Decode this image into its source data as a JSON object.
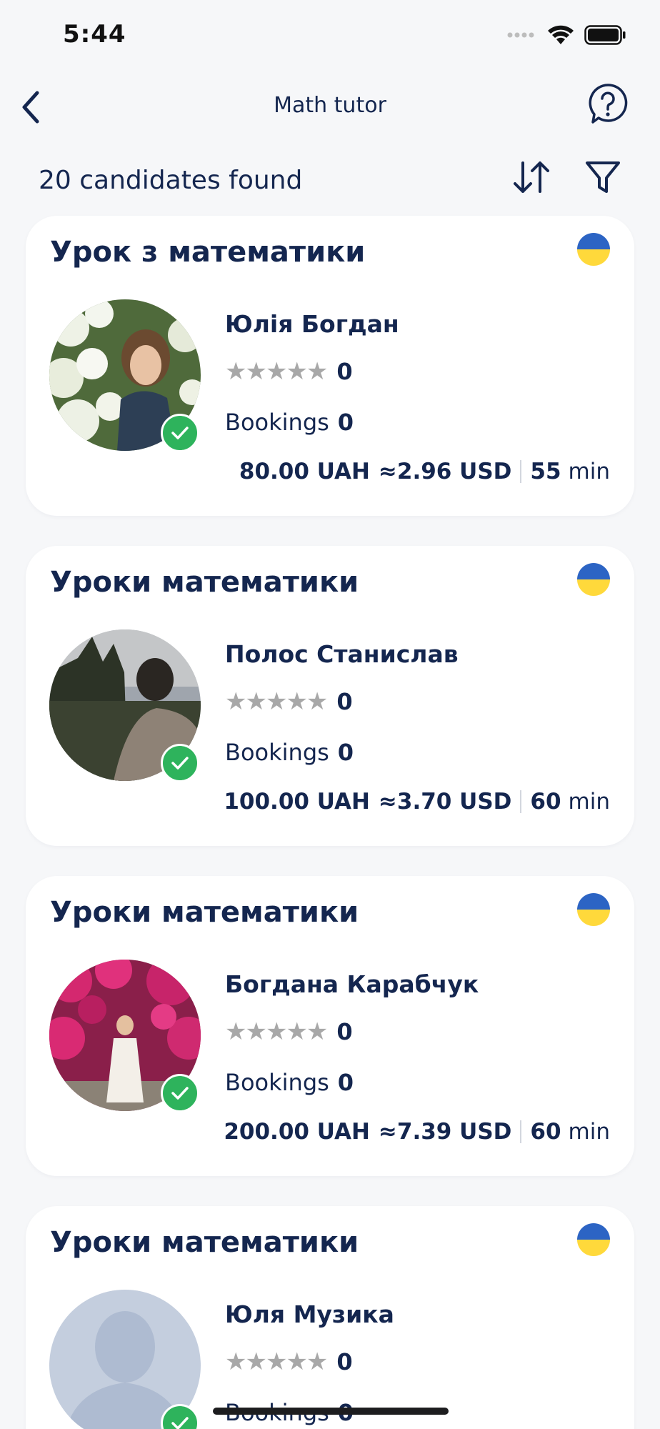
{
  "status": {
    "time": "5:44"
  },
  "nav": {
    "title": "Math tutor"
  },
  "results": {
    "count_label": "20 candidates found"
  },
  "labels": {
    "bookings": "Bookings",
    "stars": "★★★★★"
  },
  "cards": [
    {
      "title": "Урок з математики",
      "name": "Юлія Богдан",
      "rating": "0",
      "bookings": "0",
      "price": "80.00 UAH",
      "approx": "≈2.96 USD",
      "duration_value": "55",
      "duration_unit": "min"
    },
    {
      "title": "Уроки математики",
      "name": "Полос Станислав",
      "rating": "0",
      "bookings": "0",
      "price": "100.00 UAH",
      "approx": "≈3.70 USD",
      "duration_value": "60",
      "duration_unit": "min"
    },
    {
      "title": "Уроки математики",
      "name": "Богдана Карабчук",
      "rating": "0",
      "bookings": "0",
      "price": "200.00 UAH",
      "approx": "≈7.39 USD",
      "duration_value": "60",
      "duration_unit": "min"
    },
    {
      "title": "Уроки математики",
      "name": "Юля Музика",
      "rating": "0",
      "bookings": "0"
    }
  ]
}
